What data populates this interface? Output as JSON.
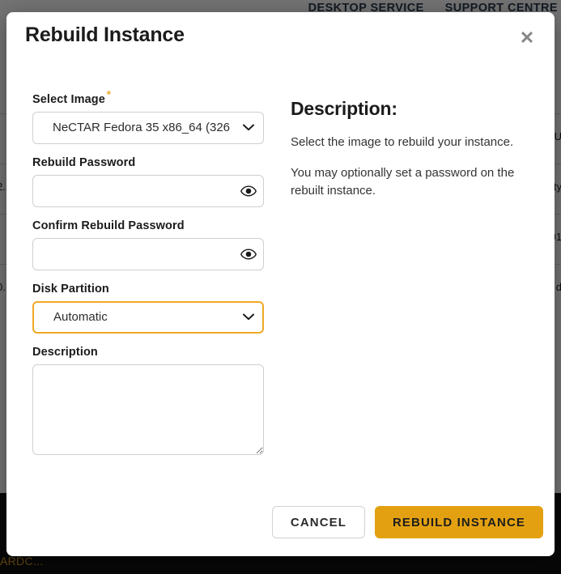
{
  "background": {
    "nav_items": [
      "DESKTOP SERVICE",
      "SUPPORT CENTRE"
    ],
    "table_fragments": [
      {
        "left": "",
        "right": "U"
      },
      {
        "left": "2.",
        "right": "ity"
      },
      {
        "left": "",
        "right": "01"
      },
      {
        "left": "0.",
        "right": "d"
      }
    ],
    "footer_link": "ARDC..."
  },
  "modal": {
    "title": "Rebuild Instance",
    "close_icon": "close-icon",
    "form": {
      "select_image": {
        "label": "Select Image",
        "required_marker": "*",
        "value": "NeCTAR Fedora 35 x86_64 (326",
        "chevron_icon": "chevron-down-icon"
      },
      "rebuild_password": {
        "label": "Rebuild Password",
        "value": "",
        "placeholder": "",
        "toggle_icon": "eye-icon"
      },
      "confirm_rebuild_password": {
        "label": "Confirm Rebuild Password",
        "value": "",
        "placeholder": "",
        "toggle_icon": "eye-icon"
      },
      "disk_partition": {
        "label": "Disk Partition",
        "value": "Automatic",
        "chevron_icon": "chevron-down-icon"
      },
      "description": {
        "label": "Description",
        "value": "",
        "placeholder": ""
      }
    },
    "description_panel": {
      "heading": "Description:",
      "paragraph_1": "Select the image to rebuild your instance.",
      "paragraph_2": "You may optionally set a password on the rebuilt instance."
    },
    "footer": {
      "cancel_label": "CANCEL",
      "primary_label": "REBUILD INSTANCE"
    }
  },
  "colors": {
    "accent": "#e3a112",
    "required_star": "#f0a825",
    "focus_border": "#f0a825",
    "text_primary": "#1b1b1b",
    "footer_link": "#e0a020"
  }
}
